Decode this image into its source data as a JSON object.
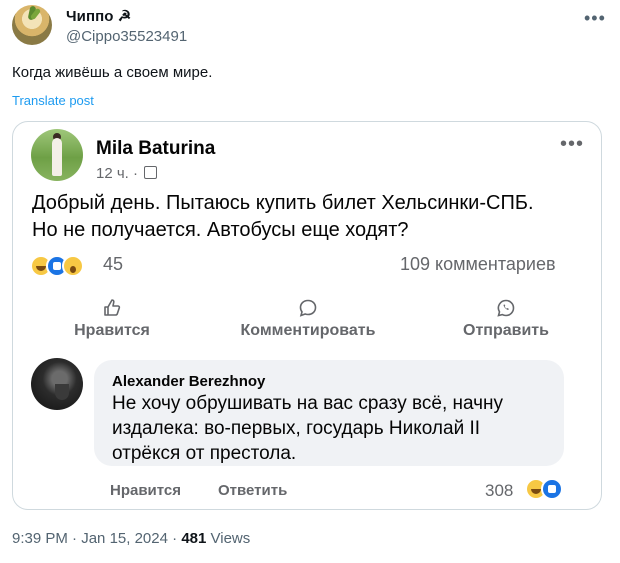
{
  "tweet": {
    "author_name": "Чиппо ☭",
    "author_handle": "@Cippo35523491",
    "text": "Когда живёшь  а своем мире.",
    "translate_label": "Translate post",
    "more_label": "•••",
    "time": "9:39 PM",
    "date": "Jan 15, 2024",
    "views_count": "481",
    "views_label": "Views"
  },
  "embedded_post": {
    "author_name": "Mila Baturina",
    "time_ago": "12 ч.",
    "more_label": "•••",
    "text_line1": "Добрый день. Пытаюсь купить билет Хельсинки-СПБ.",
    "text_line2": "Но не получается. Автобусы еще ходят?",
    "reaction_count": "45",
    "comments_count": "109 комментариев",
    "actions": {
      "like": "Нравится",
      "comment": "Комментировать",
      "share": "Отправить"
    },
    "reactions": [
      "haha-icon",
      "like-icon",
      "wow-icon"
    ]
  },
  "comment": {
    "author_name": "Alexander Berezhnoy",
    "text_line1": "Не хочу обрушивать на вас сразу всё, начну",
    "text_line2": "издалека: во-первых, государь Николай II",
    "text_line3": "отрёкся от престола.",
    "like_label": "Нравится",
    "reply_label": "Ответить",
    "reaction_count": "308"
  },
  "colors": {
    "link": "#1d9bf0",
    "secondary_text": "#536471",
    "fb_secondary": "#65676b",
    "bubble_bg": "#f0f2f5",
    "like_blue": "#1b74e4"
  }
}
